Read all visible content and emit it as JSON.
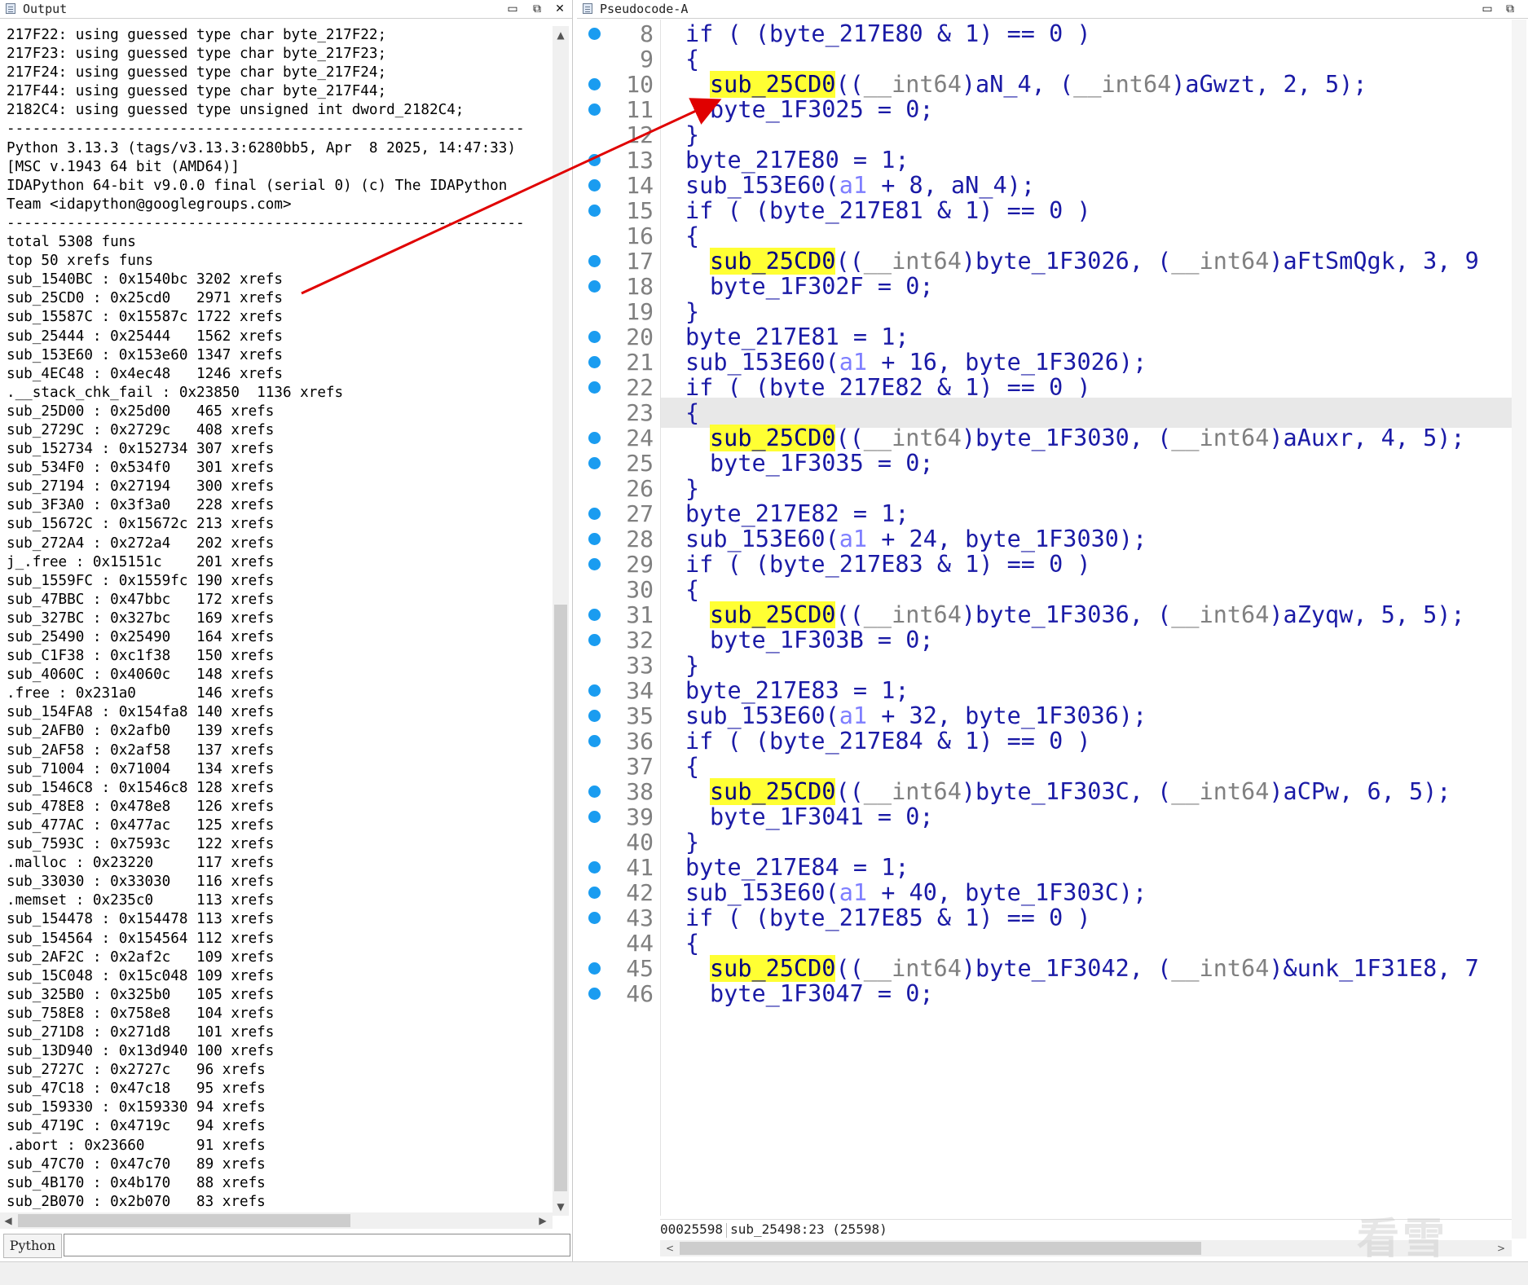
{
  "output_pane": {
    "title": "Output",
    "lines": [
      "217F22: using guessed type char byte_217F22;",
      "217F23: using guessed type char byte_217F23;",
      "217F24: using guessed type char byte_217F24;",
      "217F44: using guessed type char byte_217F44;",
      "2182C4: using guessed type unsigned int dword_2182C4;",
      "------------------------------------------------------------",
      "Python 3.13.3 (tags/v3.13.3:6280bb5, Apr  8 2025, 14:47:33)",
      "[MSC v.1943 64 bit (AMD64)]",
      "IDAPython 64-bit v9.0.0 final (serial 0) (c) The IDAPython",
      "Team <idapython@googlegroups.com>",
      "------------------------------------------------------------",
      "total 5308 funs",
      "top 50 xrefs funs",
      "sub_1540BC : 0x1540bc 3202 xrefs",
      "sub_25CD0 : 0x25cd0   2971 xrefs",
      "sub_15587C : 0x15587c 1722 xrefs",
      "sub_25444 : 0x25444   1562 xrefs",
      "sub_153E60 : 0x153e60 1347 xrefs",
      "sub_4EC48 : 0x4ec48   1246 xrefs",
      ".__stack_chk_fail : 0x23850  1136 xrefs",
      "sub_25D00 : 0x25d00   465 xrefs",
      "sub_2729C : 0x2729c   408 xrefs",
      "sub_152734 : 0x152734 307 xrefs",
      "sub_534F0 : 0x534f0   301 xrefs",
      "sub_27194 : 0x27194   300 xrefs",
      "sub_3F3A0 : 0x3f3a0   228 xrefs",
      "sub_15672C : 0x15672c 213 xrefs",
      "sub_272A4 : 0x272a4   202 xrefs",
      "j_.free : 0x15151c    201 xrefs",
      "sub_1559FC : 0x1559fc 190 xrefs",
      "sub_47BBC : 0x47bbc   172 xrefs",
      "sub_327BC : 0x327bc   169 xrefs",
      "sub_25490 : 0x25490   164 xrefs",
      "sub_C1F38 : 0xc1f38   150 xrefs",
      "sub_4060C : 0x4060c   148 xrefs",
      ".free : 0x231a0       146 xrefs",
      "sub_154FA8 : 0x154fa8 140 xrefs",
      "sub_2AFB0 : 0x2afb0   139 xrefs",
      "sub_2AF58 : 0x2af58   137 xrefs",
      "sub_71004 : 0x71004   134 xrefs",
      "sub_1546C8 : 0x1546c8 128 xrefs",
      "sub_478E8 : 0x478e8   126 xrefs",
      "sub_477AC : 0x477ac   125 xrefs",
      "sub_7593C : 0x7593c   122 xrefs",
      ".malloc : 0x23220     117 xrefs",
      "sub_33030 : 0x33030   116 xrefs",
      ".memset : 0x235c0     113 xrefs",
      "sub_154478 : 0x154478 113 xrefs",
      "sub_154564 : 0x154564 112 xrefs",
      "sub_2AF2C : 0x2af2c   109 xrefs",
      "sub_15C048 : 0x15c048 109 xrefs",
      "sub_325B0 : 0x325b0   105 xrefs",
      "sub_758E8 : 0x758e8   104 xrefs",
      "sub_271D8 : 0x271d8   101 xrefs",
      "sub_13D940 : 0x13d940 100 xrefs",
      "sub_2727C : 0x2727c   96 xrefs",
      "sub_47C18 : 0x47c18   95 xrefs",
      "sub_159330 : 0x159330 94 xrefs",
      "sub_4719C : 0x4719c   94 xrefs",
      ".abort : 0x23660      91 xrefs",
      "sub_47C70 : 0x47c70   89 xrefs",
      "sub_4B170 : 0x4b170   88 xrefs",
      "sub_2B070 : 0x2b070   83 xrefs"
    ],
    "input_label": "Python",
    "input_value": ""
  },
  "pseudocode_pane": {
    "title": "Pseudocode-A",
    "lines": [
      {
        "num": "8",
        "dot": true,
        "indent": 0,
        "segs": [
          [
            "t",
            "if ( (byte_217E80 & 1) == 0 )"
          ]
        ]
      },
      {
        "num": "9",
        "dot": false,
        "indent": 0,
        "segs": [
          [
            "t",
            "{"
          ]
        ]
      },
      {
        "num": "10",
        "dot": true,
        "indent": 1,
        "segs": [
          [
            "h",
            "sub_25CD0"
          ],
          [
            "t",
            "(("
          ],
          [
            "g",
            "__int64"
          ],
          [
            "t",
            ")aN_4, ("
          ],
          [
            "g",
            "__int64"
          ],
          [
            "t",
            ")aGwzt, 2, 5);"
          ]
        ]
      },
      {
        "num": "11",
        "dot": true,
        "indent": 1,
        "segs": [
          [
            "t",
            "byte_1F3025 = 0;"
          ]
        ]
      },
      {
        "num": "12",
        "dot": false,
        "indent": 0,
        "segs": [
          [
            "t",
            "}"
          ]
        ]
      },
      {
        "num": "13",
        "dot": true,
        "indent": 0,
        "segs": [
          [
            "t",
            "byte_217E80 = 1;"
          ]
        ]
      },
      {
        "num": "14",
        "dot": true,
        "indent": 0,
        "segs": [
          [
            "t",
            "sub_153E60("
          ],
          [
            "a",
            "a1"
          ],
          [
            "t",
            " + 8, aN_4);"
          ]
        ]
      },
      {
        "num": "15",
        "dot": true,
        "indent": 0,
        "segs": [
          [
            "t",
            "if ( (byte_217E81 & 1) == 0 )"
          ]
        ]
      },
      {
        "num": "16",
        "dot": false,
        "indent": 0,
        "segs": [
          [
            "t",
            "{"
          ]
        ]
      },
      {
        "num": "17",
        "dot": true,
        "indent": 1,
        "segs": [
          [
            "h",
            "sub_25CD0"
          ],
          [
            "t",
            "(("
          ],
          [
            "g",
            "__int64"
          ],
          [
            "t",
            ")byte_1F3026, ("
          ],
          [
            "g",
            "__int64"
          ],
          [
            "t",
            ")aFtSmQgk, 3, 9"
          ]
        ]
      },
      {
        "num": "18",
        "dot": true,
        "indent": 1,
        "segs": [
          [
            "t",
            "byte_1F302F = 0;"
          ]
        ]
      },
      {
        "num": "19",
        "dot": false,
        "indent": 0,
        "segs": [
          [
            "t",
            "}"
          ]
        ]
      },
      {
        "num": "20",
        "dot": true,
        "indent": 0,
        "segs": [
          [
            "t",
            "byte_217E81 = 1;"
          ]
        ]
      },
      {
        "num": "21",
        "dot": true,
        "indent": 0,
        "segs": [
          [
            "t",
            "sub_153E60("
          ],
          [
            "a",
            "a1"
          ],
          [
            "t",
            " + 16, byte_1F3026);"
          ]
        ]
      },
      {
        "num": "22",
        "dot": true,
        "indent": 0,
        "segs": [
          [
            "t",
            "if ( (byte_217E82 & 1) == 0 )"
          ]
        ]
      },
      {
        "num": "23",
        "dot": false,
        "indent": 0,
        "cur": true,
        "segs": [
          [
            "t",
            "{"
          ]
        ]
      },
      {
        "num": "24",
        "dot": true,
        "indent": 1,
        "segs": [
          [
            "h",
            "sub_25CD0"
          ],
          [
            "t",
            "(("
          ],
          [
            "g",
            "__int64"
          ],
          [
            "t",
            ")byte_1F3030, ("
          ],
          [
            "g",
            "__int64"
          ],
          [
            "t",
            ")aAuxr, 4, 5);"
          ]
        ]
      },
      {
        "num": "25",
        "dot": true,
        "indent": 1,
        "segs": [
          [
            "t",
            "byte_1F3035 = 0;"
          ]
        ]
      },
      {
        "num": "26",
        "dot": false,
        "indent": 0,
        "segs": [
          [
            "t",
            "}"
          ]
        ]
      },
      {
        "num": "27",
        "dot": true,
        "indent": 0,
        "segs": [
          [
            "t",
            "byte_217E82 = 1;"
          ]
        ]
      },
      {
        "num": "28",
        "dot": true,
        "indent": 0,
        "segs": [
          [
            "t",
            "sub_153E60("
          ],
          [
            "a",
            "a1"
          ],
          [
            "t",
            " + 24, byte_1F3030);"
          ]
        ]
      },
      {
        "num": "29",
        "dot": true,
        "indent": 0,
        "segs": [
          [
            "t",
            "if ( (byte_217E83 & 1) == 0 )"
          ]
        ]
      },
      {
        "num": "30",
        "dot": false,
        "indent": 0,
        "segs": [
          [
            "t",
            "{"
          ]
        ]
      },
      {
        "num": "31",
        "dot": true,
        "indent": 1,
        "segs": [
          [
            "h",
            "sub_25CD0"
          ],
          [
            "t",
            "(("
          ],
          [
            "g",
            "__int64"
          ],
          [
            "t",
            ")byte_1F3036, ("
          ],
          [
            "g",
            "__int64"
          ],
          [
            "t",
            ")aZyqw, 5, 5);"
          ]
        ]
      },
      {
        "num": "32",
        "dot": true,
        "indent": 1,
        "segs": [
          [
            "t",
            "byte_1F303B = 0;"
          ]
        ]
      },
      {
        "num": "33",
        "dot": false,
        "indent": 0,
        "segs": [
          [
            "t",
            "}"
          ]
        ]
      },
      {
        "num": "34",
        "dot": true,
        "indent": 0,
        "segs": [
          [
            "t",
            "byte_217E83 = 1;"
          ]
        ]
      },
      {
        "num": "35",
        "dot": true,
        "indent": 0,
        "segs": [
          [
            "t",
            "sub_153E60("
          ],
          [
            "a",
            "a1"
          ],
          [
            "t",
            " + 32, byte_1F3036);"
          ]
        ]
      },
      {
        "num": "36",
        "dot": true,
        "indent": 0,
        "segs": [
          [
            "t",
            "if ( (byte_217E84 & 1) == 0 )"
          ]
        ]
      },
      {
        "num": "37",
        "dot": false,
        "indent": 0,
        "segs": [
          [
            "t",
            "{"
          ]
        ]
      },
      {
        "num": "38",
        "dot": true,
        "indent": 1,
        "segs": [
          [
            "h",
            "sub_25CD0"
          ],
          [
            "t",
            "(("
          ],
          [
            "g",
            "__int64"
          ],
          [
            "t",
            ")byte_1F303C, ("
          ],
          [
            "g",
            "__int64"
          ],
          [
            "t",
            ")aCPw, 6, 5);"
          ]
        ]
      },
      {
        "num": "39",
        "dot": true,
        "indent": 1,
        "segs": [
          [
            "t",
            "byte_1F3041 = 0;"
          ]
        ]
      },
      {
        "num": "40",
        "dot": false,
        "indent": 0,
        "segs": [
          [
            "t",
            "}"
          ]
        ]
      },
      {
        "num": "41",
        "dot": true,
        "indent": 0,
        "segs": [
          [
            "t",
            "byte_217E84 = 1;"
          ]
        ]
      },
      {
        "num": "42",
        "dot": true,
        "indent": 0,
        "segs": [
          [
            "t",
            "sub_153E60("
          ],
          [
            "a",
            "a1"
          ],
          [
            "t",
            " + 40, byte_1F303C);"
          ]
        ]
      },
      {
        "num": "43",
        "dot": true,
        "indent": 0,
        "segs": [
          [
            "t",
            "if ( (byte_217E85 & 1) == 0 )"
          ]
        ]
      },
      {
        "num": "44",
        "dot": false,
        "indent": 0,
        "segs": [
          [
            "t",
            "{"
          ]
        ]
      },
      {
        "num": "45",
        "dot": true,
        "indent": 1,
        "segs": [
          [
            "h",
            "sub_25CD0"
          ],
          [
            "t",
            "(("
          ],
          [
            "g",
            "__int64"
          ],
          [
            "t",
            ")byte_1F3042, ("
          ],
          [
            "g",
            "__int64"
          ],
          [
            "t",
            ")&unk_1F31E8, 7"
          ]
        ]
      },
      {
        "num": "46",
        "dot": true,
        "indent": 1,
        "segs": [
          [
            "t",
            "byte_1F3047 = 0;"
          ]
        ]
      }
    ],
    "status": {
      "address": "00025598",
      "location": "sub_25498:23 (25598)"
    }
  },
  "watermark": "看雪",
  "colors": {
    "code": "#1a1aa6",
    "type": "#808080",
    "arg": "#7e7eff",
    "highlight": "#ffff33",
    "dot": "#1a9cf0",
    "annotation_arrow": "#e00000"
  },
  "icons": [
    "window-icon",
    "minimize-icon",
    "restore-icon",
    "close-icon",
    "scroll-up-icon",
    "scroll-down-icon",
    "scroll-left-icon",
    "scroll-right-icon"
  ]
}
